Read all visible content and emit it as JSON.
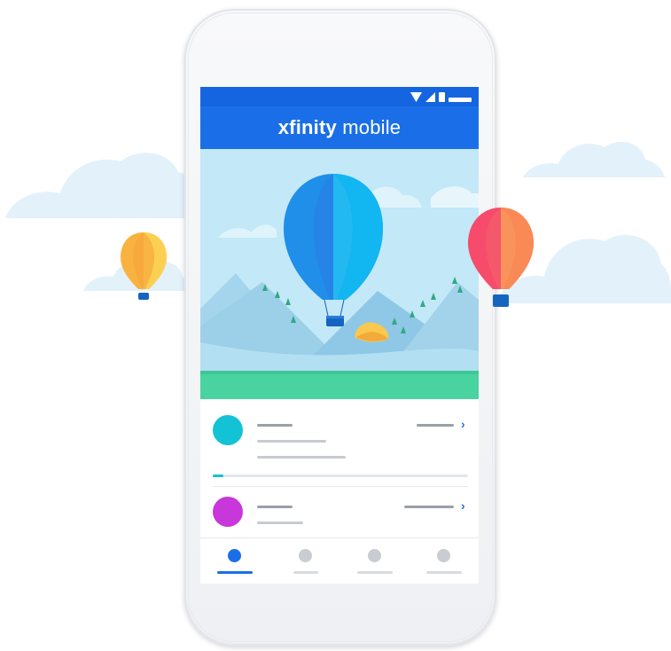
{
  "app": {
    "brand_part1": "xfinity",
    "brand_part2": "mobile"
  },
  "colors": {
    "status_bar": "#1565e0",
    "app_bar": "#1a6fe8",
    "sky": "#bfe6f6",
    "grass": "#48d3a0",
    "account_avatar_1": "#14c2d6",
    "account_avatar_2": "#c737d9",
    "nav_active": "#1a6fe8",
    "nav_inactive": "#c9ccd1"
  },
  "status_bar": {
    "icons": [
      "wifi-icon",
      "signal-icon",
      "battery-icon"
    ]
  },
  "accounts": [
    {
      "avatar_color": "#14c2d6",
      "chevron": "›",
      "usage_fraction": 0.04
    },
    {
      "avatar_color": "#c737d9",
      "chevron": "›"
    }
  ],
  "bottom_nav": {
    "items": [
      {
        "name": "nav-item-1",
        "active": true
      },
      {
        "name": "nav-item-2",
        "active": false
      },
      {
        "name": "nav-item-3",
        "active": false
      },
      {
        "name": "nav-item-4",
        "active": false
      }
    ]
  }
}
